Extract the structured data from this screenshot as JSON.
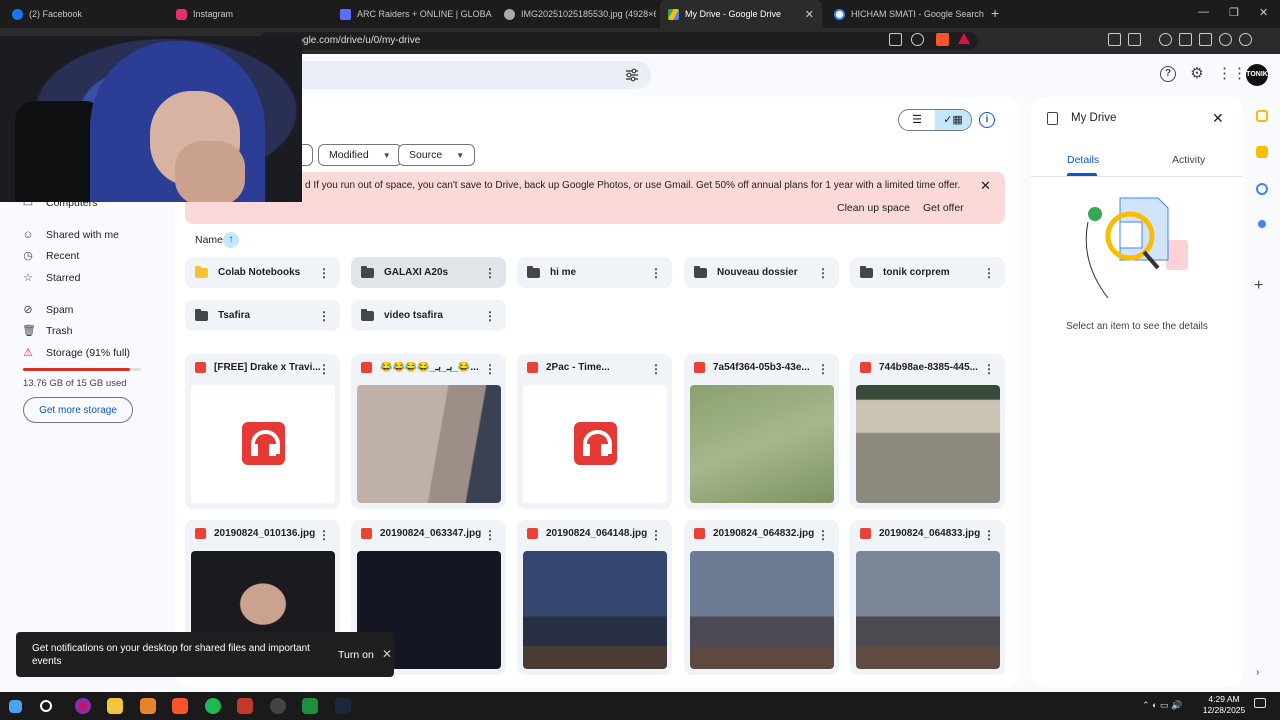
{
  "browser": {
    "tabs": [
      {
        "label": "(2) Facebook",
        "color": "#1877f2"
      },
      {
        "label": "Instagram",
        "color": "#e1306c"
      },
      {
        "label": "ARC Raiders + ONLINE | GLOBAL | AI",
        "color": "#5b6cff"
      },
      {
        "label": "IMG20251025185530.jpg (4928×65",
        "color": "#aaaaaa"
      },
      {
        "label": "My Drive - Google Drive",
        "color": "#34a853",
        "active": true
      },
      {
        "label": "HICHAM SMATI - Google Search",
        "color": "#ffffff"
      }
    ],
    "url": "e.google.com/drive/u/0/my-drive"
  },
  "sidebar": {
    "items": [
      {
        "label": "Computers",
        "icon": "computer-icon"
      },
      {
        "label": "Shared with me",
        "icon": "people-icon"
      },
      {
        "label": "Recent",
        "icon": "clock-icon"
      },
      {
        "label": "Starred",
        "icon": "star-icon"
      },
      {
        "label": "Spam",
        "icon": "spam-icon"
      },
      {
        "label": "Trash",
        "icon": "trash-icon"
      },
      {
        "label": "Storage (91% full)",
        "icon": "cloud-warning-icon"
      }
    ],
    "storage_used_fraction": 0.91,
    "storage_text": "13.76 GB of 15 GB used",
    "get_storage_label": "Get more storage"
  },
  "filters": {
    "modified": "Modified",
    "source": "Source"
  },
  "banner": {
    "text": "d If you run out of space, you can't save to Drive, back up Google Photos, or use Gmail. Get 50% off annual plans for 1 year with a limited time offer.",
    "clean_up": "Clean up space",
    "get_offer": "Get offer"
  },
  "sort": {
    "label": "Name"
  },
  "folders": [
    {
      "name": "Colab Notebooks"
    },
    {
      "name": "GALAXI A20s"
    },
    {
      "name": "hi me"
    },
    {
      "name": "Nouveau dossier"
    },
    {
      "name": "tonik corprem"
    },
    {
      "name": "Tsafira"
    },
    {
      "name": "video tsafira"
    }
  ],
  "files_row1": [
    {
      "name": "[FREE] Drake x Travi...",
      "kind": "audio"
    },
    {
      "name": "😂😂😂😂_بـ_بـ_😂...",
      "kind": "video"
    },
    {
      "name": "2Pac - Time...",
      "kind": "audio"
    },
    {
      "name": "7a54f364-05b3-43e...",
      "kind": "image"
    },
    {
      "name": "744b98ae-8385-445...",
      "kind": "image"
    }
  ],
  "files_row2": [
    {
      "name": "20190824_010136.jpg",
      "kind": "image"
    },
    {
      "name": "20190824_063347.jpg",
      "kind": "image"
    },
    {
      "name": "20190824_064148.jpg",
      "kind": "image"
    },
    {
      "name": "20190824_064832.jpg",
      "kind": "image"
    },
    {
      "name": "20190824_064833.jpg",
      "kind": "image"
    }
  ],
  "details": {
    "title": "My Drive",
    "tab_details": "Details",
    "tab_activity": "Activity",
    "empty": "Select an item to see the details"
  },
  "toast": {
    "text": "Get notifications on your desktop for shared files and important events",
    "button": "Turn on"
  },
  "clock": {
    "time": "4:29 AM",
    "date": "12/28/2025"
  },
  "colors": {
    "accent": "#0b57d0",
    "banner": "#fcd9d9",
    "warning": "#d93025"
  }
}
